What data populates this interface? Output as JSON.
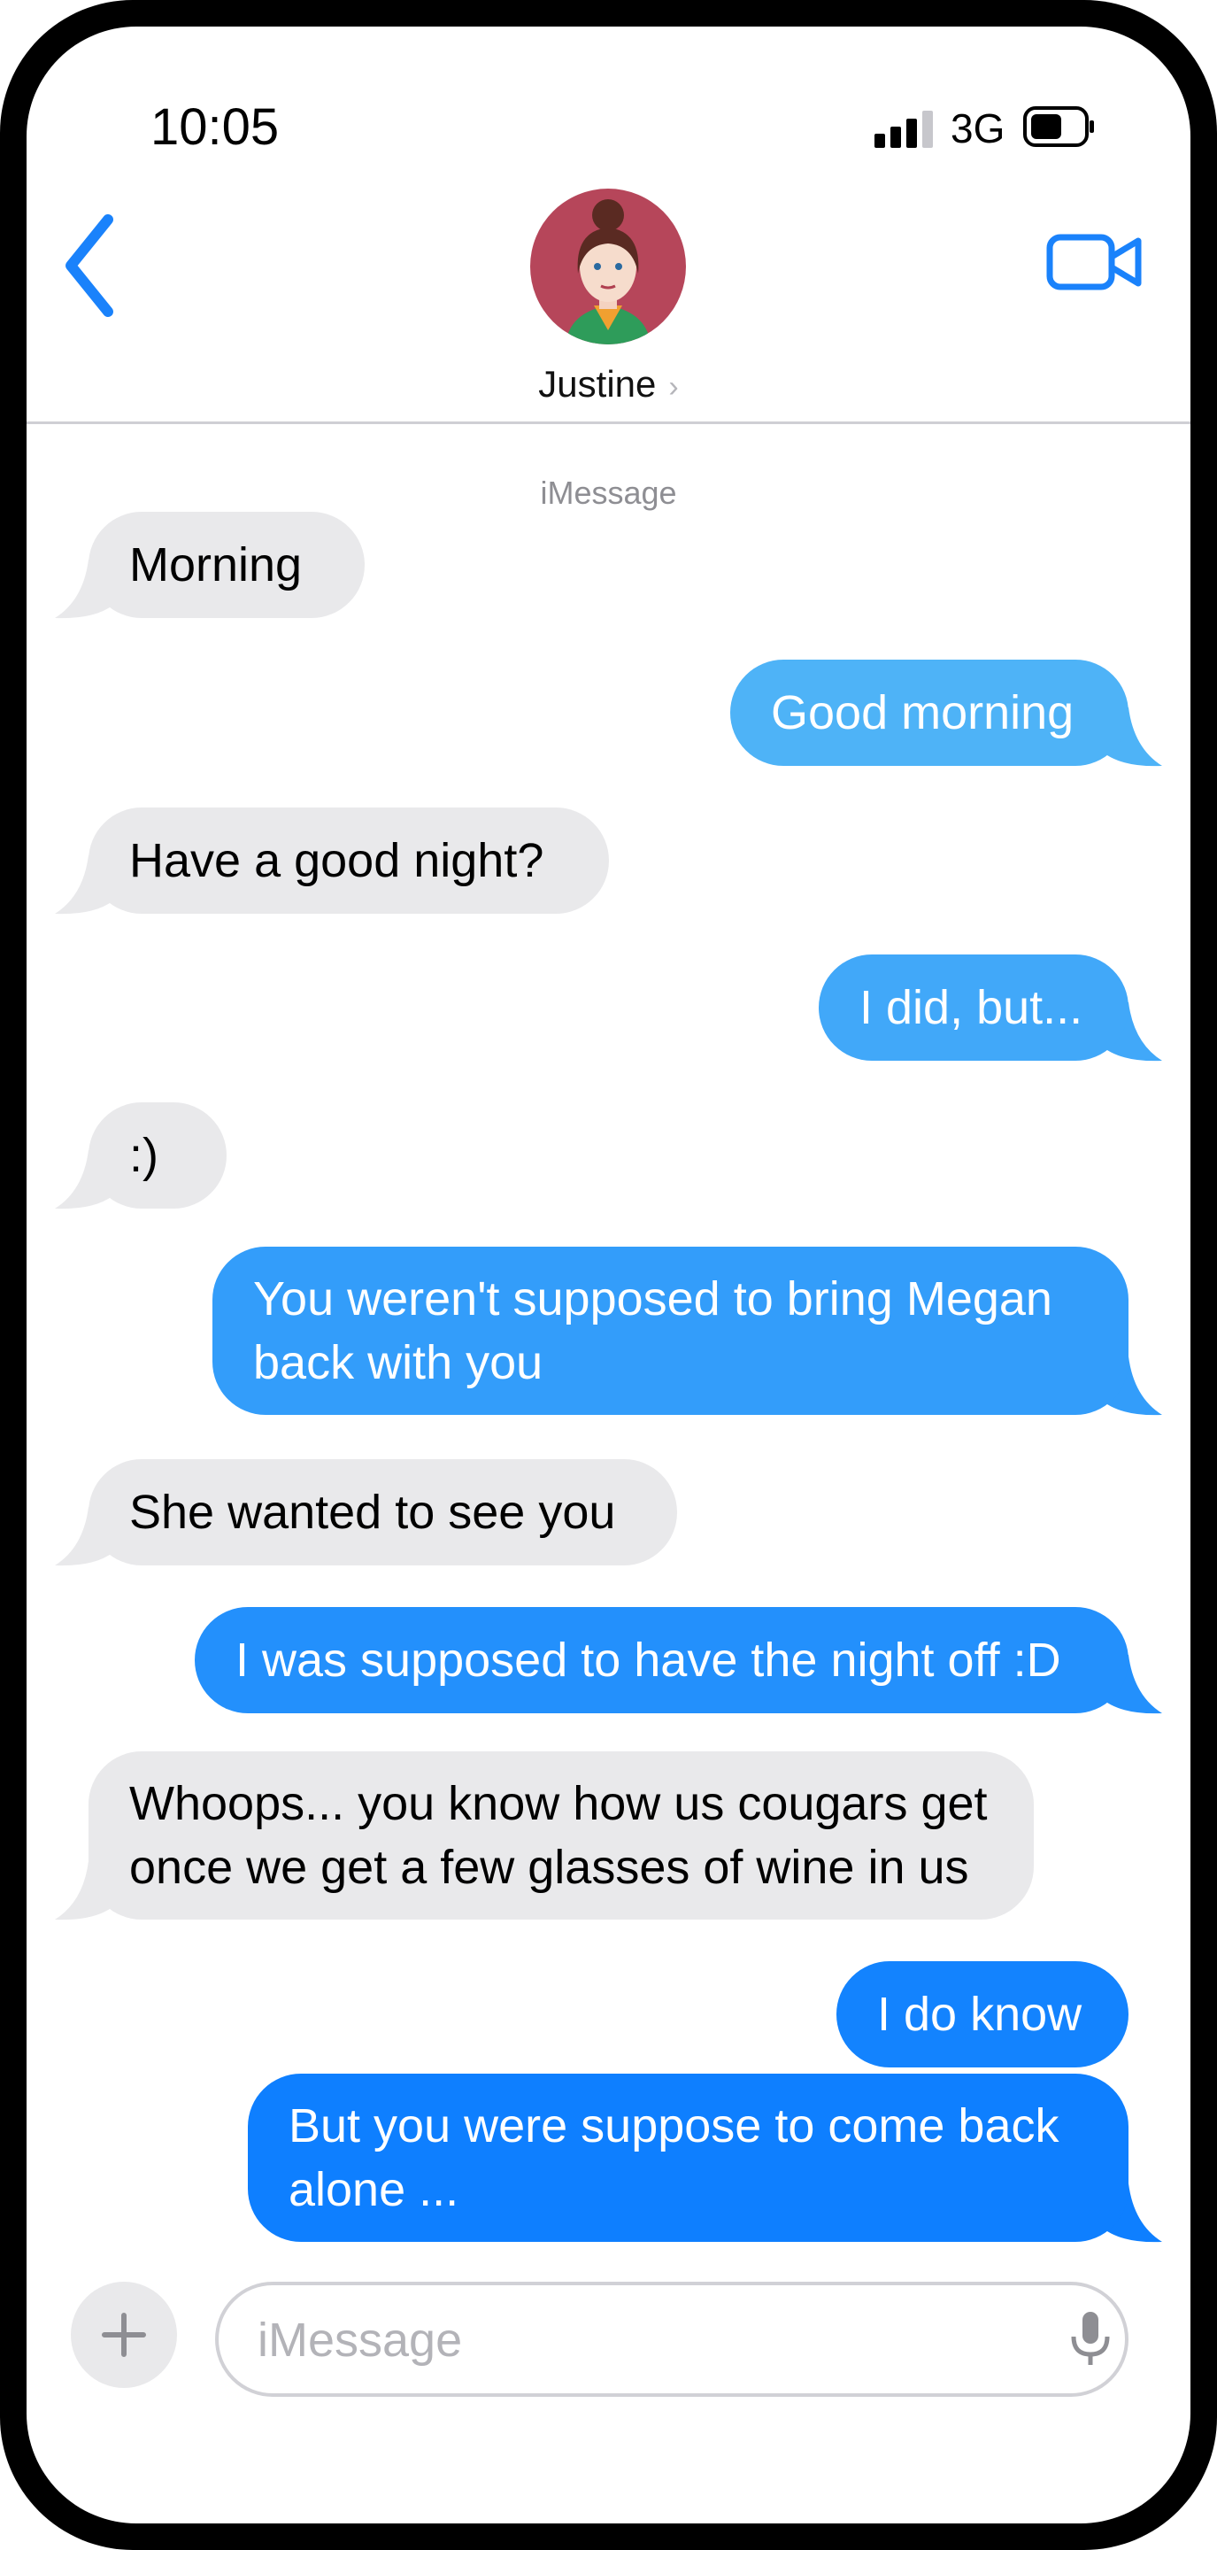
{
  "status_bar": {
    "time": "10:05",
    "carrier": "3G"
  },
  "header": {
    "contact_name": "Justine",
    "service_label": "iMessage"
  },
  "messages": [
    {
      "sender": "them",
      "text": "Morning"
    },
    {
      "sender": "me",
      "text": "Good morning"
    },
    {
      "sender": "them",
      "text": "Have a good night?"
    },
    {
      "sender": "me",
      "text": "I did, but..."
    },
    {
      "sender": "them",
      "text": ":)"
    },
    {
      "sender": "me",
      "text": "You weren't supposed to bring Megan back with you"
    },
    {
      "sender": "them",
      "text": "She wanted to see you"
    },
    {
      "sender": "me",
      "text": "I was supposed to have the night off :D"
    },
    {
      "sender": "them",
      "text": "Whoops... you know how us cougars get once we get a few glasses of wine in us"
    },
    {
      "sender": "me",
      "text": "I do know"
    },
    {
      "sender": "me",
      "text": "But you were suppose to come back alone ..."
    }
  ],
  "input": {
    "placeholder": "iMessage",
    "value": ""
  },
  "colors": {
    "accent": "#1a82fb",
    "incoming_bubble": "#e9e9eb",
    "outgoing_gradient_top": "#4fb3f7",
    "outgoing_gradient_bottom": "#0a7cff"
  },
  "icons": [
    "signal-icon",
    "battery-icon",
    "back-chevron-icon",
    "video-camera-icon",
    "avatar",
    "plus-icon",
    "microphone-icon"
  ]
}
